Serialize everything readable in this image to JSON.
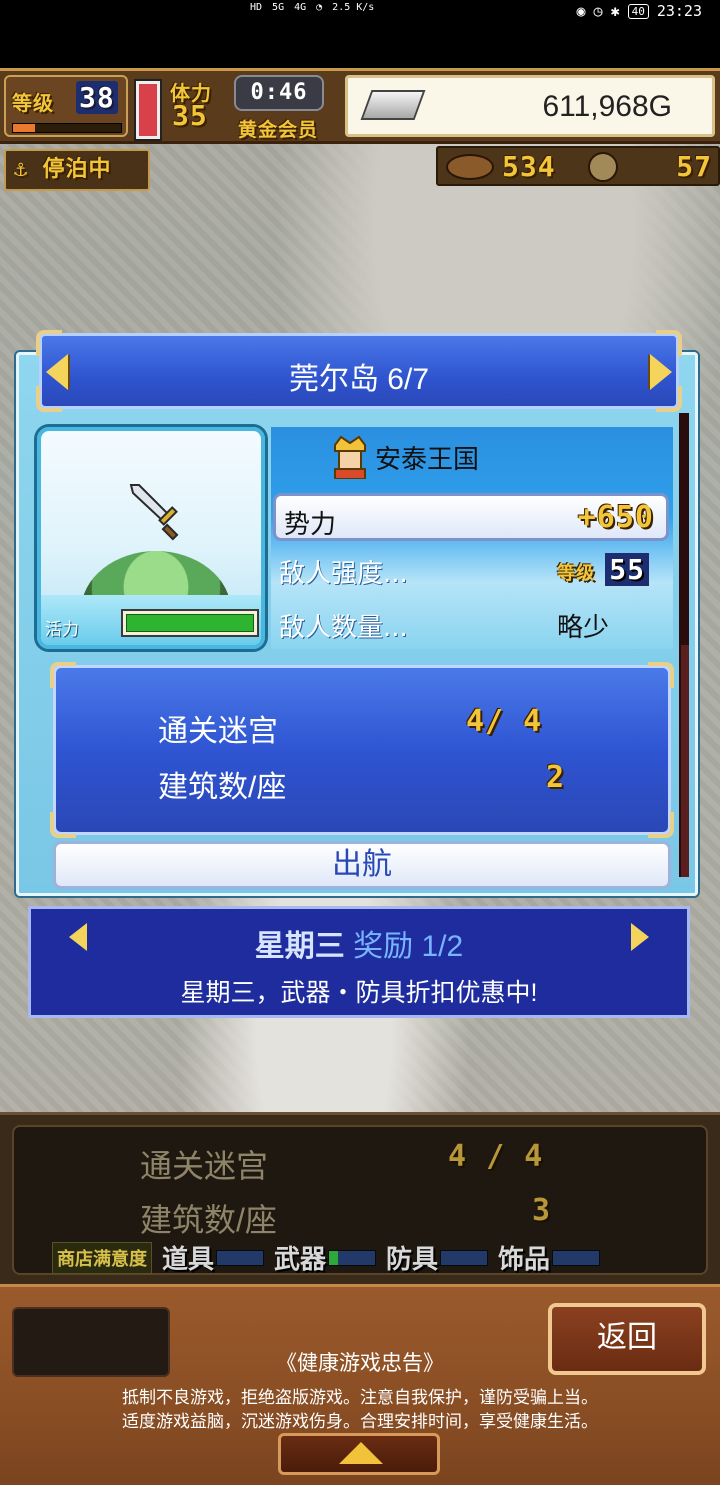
{
  "status_bar": {
    "net_labels": [
      "HD",
      "5G",
      "4G"
    ],
    "net_speed": "2.5 K/s",
    "battery": "40",
    "time": "23:23",
    "icons": [
      "wifi-icon",
      "eye-icon",
      "alarm-icon",
      "bluetooth-icon",
      "battery-icon"
    ]
  },
  "hud": {
    "level_label": "等级",
    "level": "38",
    "level_progress": 0.2,
    "hp_fraction": 1.0,
    "gem_label": "体力",
    "gems": "35",
    "timer": "0:46",
    "member_label": "黄金会员",
    "gold": "611,968G",
    "docked_label": "停泊中",
    "resource1": "534",
    "resource2": "57"
  },
  "island": {
    "title": "莞尔岛 6/7",
    "vitality_label": "活力",
    "vitality_fraction": 1.0,
    "kingdom": "安泰王国",
    "power_label": "势力",
    "power_value": "+650",
    "enemy_strength_label": "敌人强度...",
    "enemy_level_label": "等级",
    "enemy_level": "55",
    "enemy_count_label": "敌人数量...",
    "enemy_count": "略少",
    "dungeons_label": "通关迷宫",
    "dungeons_value": "4/ 4",
    "buildings_label": "建筑数/座",
    "buildings_value": "2",
    "sail_button": "出航"
  },
  "bonus": {
    "day": "星期三",
    "reward": "奖励 1/2",
    "description": "星期三，武器・防具折扣优惠中!"
  },
  "lower": {
    "dungeons_label": "通关迷宫",
    "dungeons_value": "4 /  4",
    "buildings_label": "建筑数/座",
    "buildings_value": "3",
    "shop_label": "商店满意度",
    "shop_categories": [
      "道具",
      "武器",
      "防具",
      "饰品"
    ]
  },
  "bottom": {
    "back_button": "返回",
    "notice_title": "《健康游戏忠告》",
    "notice_line1": "抵制不良游戏，拒绝盗版游戏。注意自我保护，谨防受骗上当。",
    "notice_line2": "适度游戏益脑，沉迷游戏伤身。合理安排时间，享受健康生活。"
  }
}
